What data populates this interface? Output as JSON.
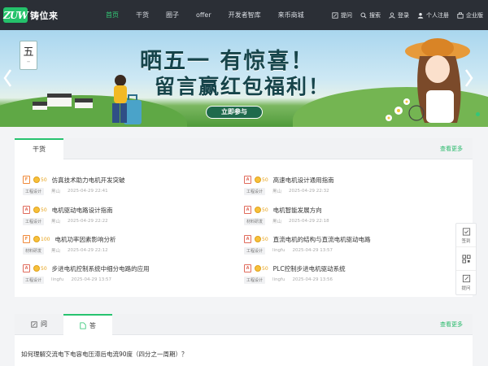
{
  "brand": {
    "logo_mark": "ZUW",
    "name": "铸位来"
  },
  "nav": {
    "items": [
      "首页",
      "干货",
      "圈子",
      "offer",
      "开发者智库",
      "来币商城"
    ],
    "active_index": 0
  },
  "header_tools": {
    "ask": "提问",
    "search": "搜索",
    "login": "登录",
    "register": "个人注册",
    "enterprise": "企业版"
  },
  "banner": {
    "cal_char": "五",
    "line1": "晒五一 有惊喜！",
    "line2": "留言赢红包福利！",
    "button": "立即参与"
  },
  "ganhuo": {
    "tab": "干货",
    "see_more": "查看更多",
    "items": [
      {
        "icon": "file-orange-icon",
        "icon_text": "F",
        "cost": "50",
        "title": "仿真技术助力电机开发突破",
        "tag": "工程设计",
        "author": "黑山",
        "time": "2025-04-29 22:41"
      },
      {
        "icon": "pdf-icon",
        "icon_text": "A",
        "cost": "50",
        "title": "高速电机设计通用指南",
        "tag": "工程设计",
        "author": "黑山",
        "time": "2025-04-29 22:32"
      },
      {
        "icon": "pdf-icon",
        "icon_text": "A",
        "cost": "50",
        "title": "电机驱动电路设计指南",
        "tag": "工程设计",
        "author": "黑山",
        "time": "2025-04-29 22:22"
      },
      {
        "icon": "pdf-icon",
        "icon_text": "A",
        "cost": "50",
        "title": "电机智能发展方向",
        "tag": "材料研发",
        "author": "黑山",
        "time": "2025-04-29 22:18"
      },
      {
        "icon": "file-orange-icon",
        "icon_text": "F",
        "cost": "100",
        "title": "电机功率因素影响分析",
        "tag": "材料研发",
        "author": "黑山",
        "time": "2025-04-29 22:12"
      },
      {
        "icon": "pdf-icon",
        "icon_text": "A",
        "cost": "50",
        "title": "直流电机的结构与直流电机驱动电路",
        "tag": "工程设计",
        "author": "lingfu",
        "time": "2025-04-29 13:57"
      },
      {
        "icon": "pdf-icon",
        "icon_text": "A",
        "cost": "50",
        "title": "步进电机控制系统中细分电路的应用",
        "tag": "工程设计",
        "author": "lingfu",
        "time": "2025-04-29 13:57"
      },
      {
        "icon": "pdf-icon",
        "icon_text": "A",
        "cost": "50",
        "title": "PLC控制步进电机驱动系统",
        "tag": "工程设计",
        "author": "lingfu",
        "time": "2025-04-29 13:56"
      }
    ]
  },
  "qa": {
    "tab_ask": "问",
    "tab_answer": "答",
    "active_tab": "答",
    "see_more": "查看更多",
    "question": "如何理解交流电下电容电压滞后电流90度（四分之一周期）？"
  },
  "float_bar": {
    "checkin": "签到",
    "ask": "提问"
  },
  "colors": {
    "accent": "#27c36f",
    "header_bg": "#2b2f36",
    "coin": "#f7c03b"
  }
}
